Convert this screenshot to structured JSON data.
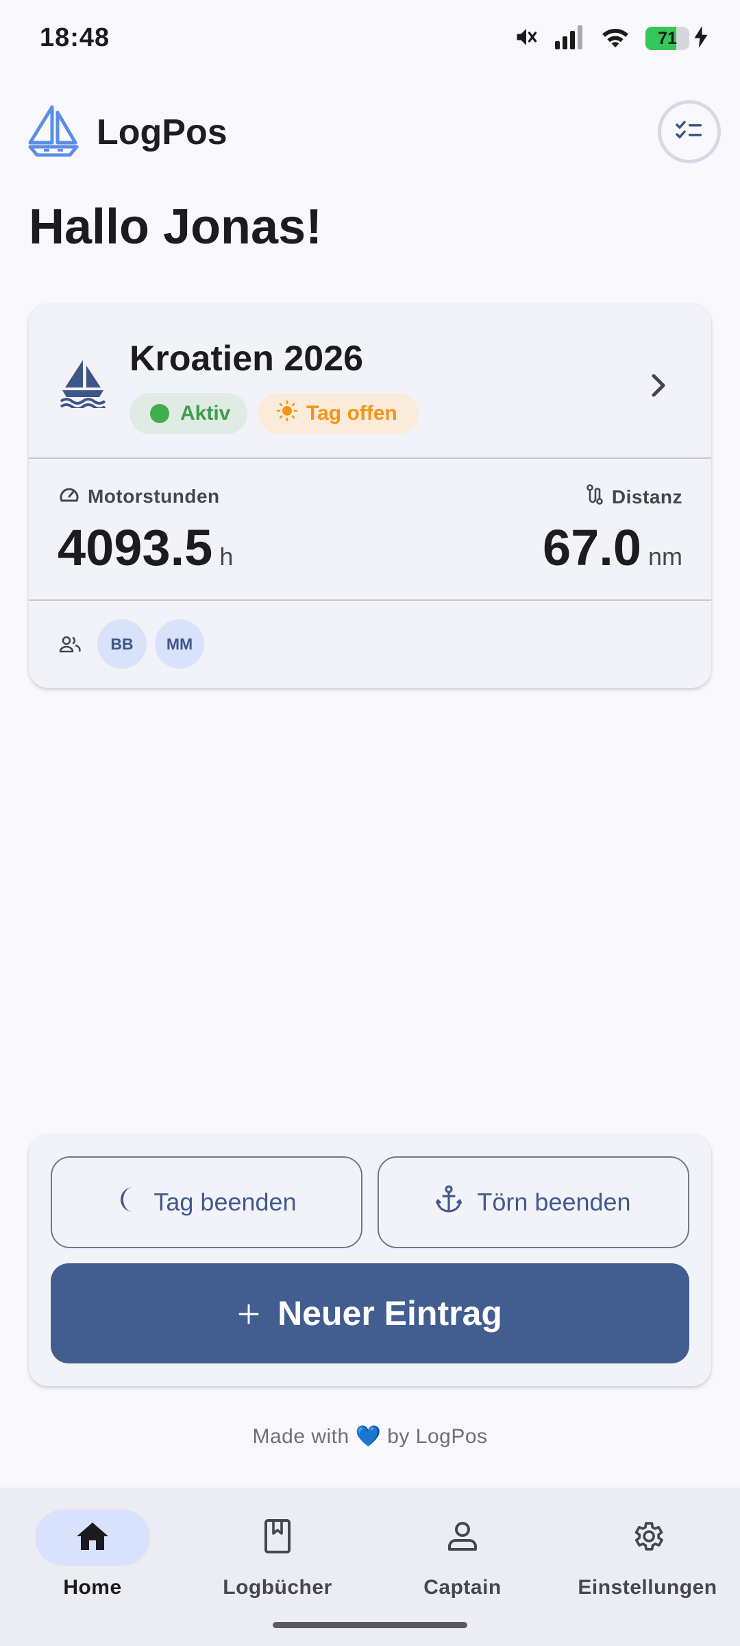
{
  "status_bar": {
    "time": "18:48",
    "battery_level": 71,
    "icons": [
      "mute-icon",
      "signal-icon",
      "wifi-icon",
      "battery-icon",
      "charging-icon"
    ]
  },
  "app_bar": {
    "app_name": "LogPos",
    "logo_icon": "sailboat-logo-icon",
    "action_icon": "checklist-icon"
  },
  "greeting": "Hallo Jonas!",
  "trip_card": {
    "name": "Kroatien 2026",
    "status_chip": "Aktiv",
    "day_chip": "Tag offen",
    "engine_hours": {
      "label": "Motorstunden",
      "value": "4093.5",
      "unit": "h"
    },
    "distance": {
      "label": "Distanz",
      "value": "67.0",
      "unit": "nm"
    },
    "crew": [
      "BB",
      "MM"
    ]
  },
  "actions": {
    "end_day": "Tag beenden",
    "end_trip": "Törn beenden",
    "new_entry": "Neuer Eintrag"
  },
  "footer": {
    "prefix": "Made with",
    "heart": "💙",
    "suffix": "by LogPos"
  },
  "nav": {
    "items": [
      {
        "label": "Home",
        "icon": "home-icon",
        "active": true
      },
      {
        "label": "Logbücher",
        "icon": "logbook-icon",
        "active": false
      },
      {
        "label": "Captain",
        "icon": "person-icon",
        "active": false
      },
      {
        "label": "Einstellungen",
        "icon": "gear-icon",
        "active": false
      }
    ]
  },
  "colors": {
    "primary": "#425d90",
    "background": "#f8f8fd",
    "active_green": "#3fae4c",
    "open_orange": "#f29518",
    "logo_blue": "#5b8ee6",
    "nav_active_pill": "#d8e2fc"
  }
}
